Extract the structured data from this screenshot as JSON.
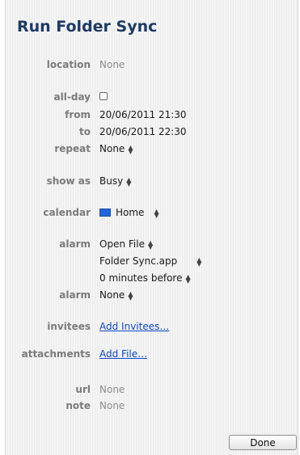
{
  "event": {
    "title": "Run Folder Sync"
  },
  "labels": {
    "location": "location",
    "all_day": "all-day",
    "from": "from",
    "to": "to",
    "repeat": "repeat",
    "show_as": "show as",
    "calendar": "calendar",
    "alarm1": "alarm",
    "alarm2": "alarm",
    "invitees": "invitees",
    "attachments": "attachments",
    "url": "url",
    "note": "note"
  },
  "values": {
    "location": "None",
    "all_day_checked": false,
    "from": "20/06/2011 21:30",
    "to": "20/06/2011 22:30",
    "repeat": "None",
    "show_as": "Busy",
    "calendar": "Home",
    "calendar_color": "#2266d8",
    "alarm1_action": "Open File",
    "alarm1_file": "Folder Sync.app",
    "alarm1_timing": "0 minutes before",
    "alarm2": "None",
    "invitees_link": "Add Invitees…",
    "attachments_link": "Add File…",
    "url": "None",
    "note": "None"
  },
  "buttons": {
    "done": "Done"
  },
  "icons": {
    "popup_arrows": "up-down-arrows-icon"
  }
}
